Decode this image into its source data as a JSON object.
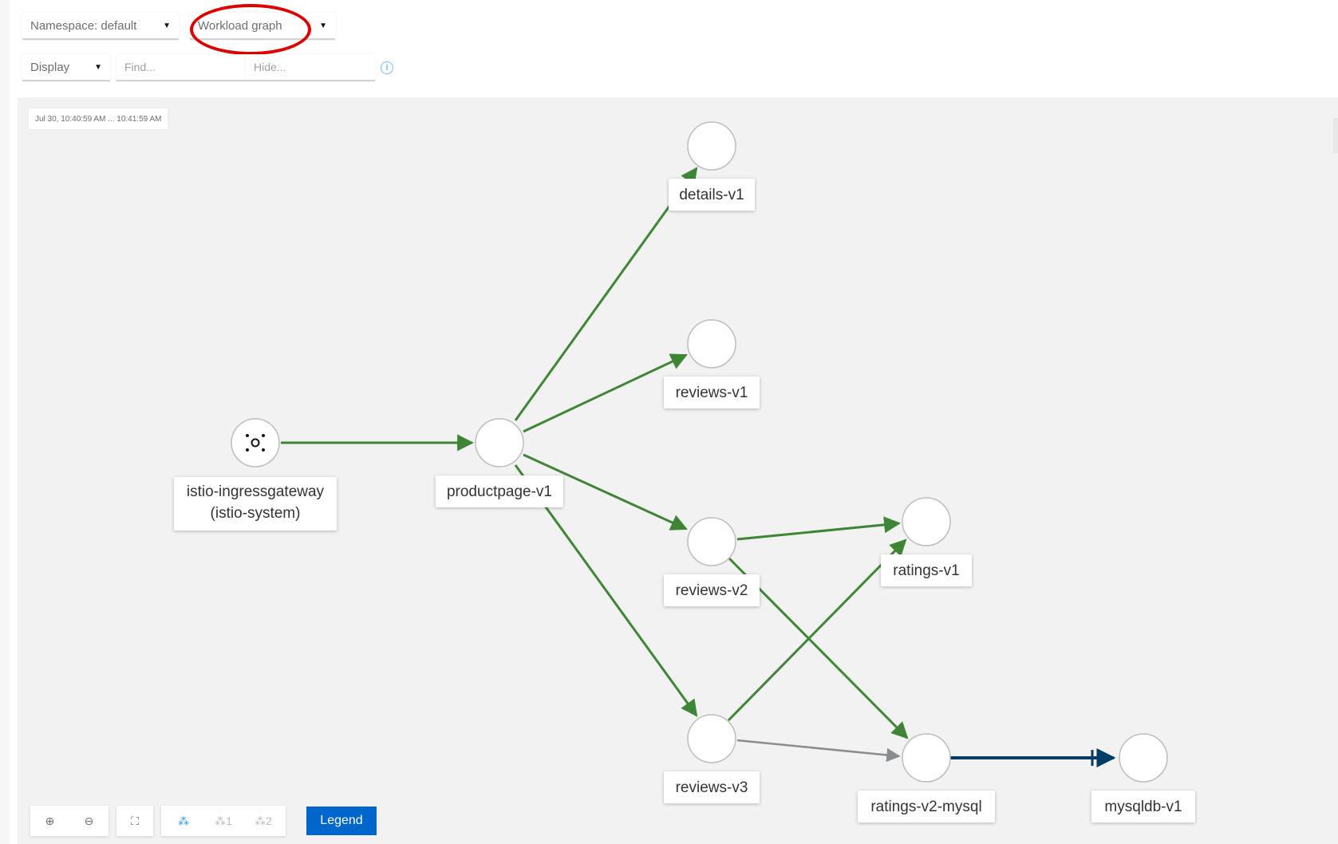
{
  "toolbar": {
    "namespace_label": "Namespace: default",
    "graph_type_label": "Workload graph",
    "display_label": "Display",
    "find_placeholder": "Find...",
    "hide_placeholder": "Hide...",
    "info_icon": "i"
  },
  "canvas": {
    "timestamp": "Jul 30, 10:40:59 AM ... 10:41:59 AM"
  },
  "graph": {
    "nodes": [
      {
        "id": "istio-ingressgateway",
        "label_line1": "istio-ingressgateway",
        "label_line2": "(istio-system)"
      },
      {
        "id": "productpage-v1",
        "label_line1": "productpage-v1"
      },
      {
        "id": "details-v1",
        "label_line1": "details-v1"
      },
      {
        "id": "reviews-v1",
        "label_line1": "reviews-v1"
      },
      {
        "id": "reviews-v2",
        "label_line1": "reviews-v2"
      },
      {
        "id": "reviews-v3",
        "label_line1": "reviews-v3"
      },
      {
        "id": "ratings-v1",
        "label_line1": "ratings-v1"
      },
      {
        "id": "ratings-v2-mysql",
        "label_line1": "ratings-v2-mysql"
      },
      {
        "id": "mysqldb-v1",
        "label_line1": "mysqldb-v1"
      }
    ],
    "edge_colors": {
      "healthy": "#3e8635",
      "idle": "#8a8d90",
      "tcp": "#003d66"
    }
  },
  "bottom_toolbar": {
    "zoom_in_icon": "⊕",
    "zoom_out_icon": "⊖",
    "fit_icon": "⛶",
    "layout_default_icon": "⁂",
    "layout_1_label": "⁂1",
    "layout_2_label": "⁂2",
    "legend_label": "Legend"
  },
  "colors": {
    "accent": "#0066cc",
    "annotation": "#e00000"
  }
}
